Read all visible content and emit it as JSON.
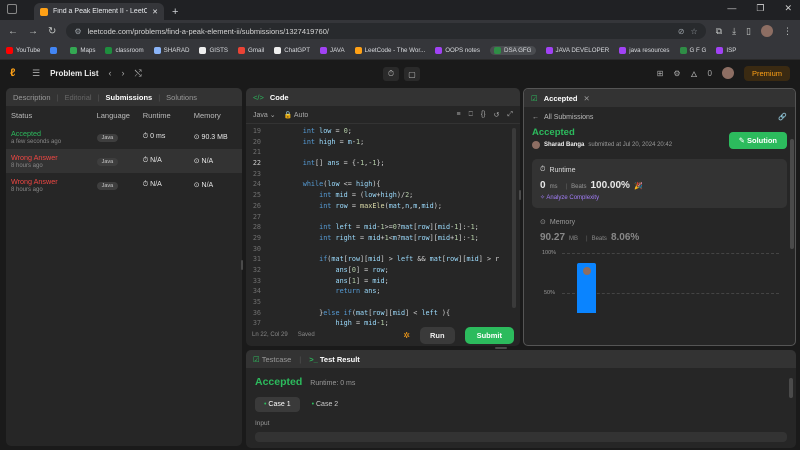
{
  "browser": {
    "tab_title": "Find a Peak Element II - LeetCo",
    "url": "leetcode.com/problems/find-a-peak-element-ii/submissions/1327419760/",
    "bookmarks": [
      {
        "label": "YouTube",
        "color": "#ff0000"
      },
      {
        "label": "",
        "color": "#4285f4"
      },
      {
        "label": "Maps",
        "color": "#34a853"
      },
      {
        "label": "classroom",
        "color": "#1e8e3e"
      },
      {
        "label": "SHARAD",
        "color": "#8ab4f8"
      },
      {
        "label": "GISTS",
        "color": "#eeeeee"
      },
      {
        "label": "Gmail",
        "color": "#ea4335"
      },
      {
        "label": "ChatGPT",
        "color": "#eeeeee"
      },
      {
        "label": "JAVA",
        "color": "#a142f4"
      },
      {
        "label": "LeetCode - The Wor...",
        "color": "#ffa116"
      },
      {
        "label": "OOPS notes",
        "color": "#a142f4"
      },
      {
        "label": "DSA GFG",
        "color": "#2f8d46"
      },
      {
        "label": "JAVA DEVELOPER",
        "color": "#a142f4"
      },
      {
        "label": "java resources",
        "color": "#a142f4"
      },
      {
        "label": "G F G",
        "color": "#2f8d46"
      },
      {
        "label": "ISP",
        "color": "#a142f4"
      }
    ]
  },
  "header": {
    "problem_list": "Problem List",
    "notifications": "0",
    "premium": "Premium"
  },
  "left_panel": {
    "tabs": [
      "Description",
      "Editorial",
      "Submissions",
      "Solutions"
    ],
    "columns": [
      "Status",
      "Language",
      "Runtime",
      "Memory"
    ],
    "rows": [
      {
        "status": "Accepted",
        "when": "a few seconds ago",
        "lang": "Java",
        "runtime": "0 ms",
        "memory": "90.3 MB"
      },
      {
        "status": "Wrong Answer",
        "when": "8 hours ago",
        "lang": "Java",
        "runtime": "N/A",
        "memory": "N/A"
      },
      {
        "status": "Wrong Answer",
        "when": "8 hours ago",
        "lang": "Java",
        "runtime": "N/A",
        "memory": "N/A"
      }
    ]
  },
  "code_panel": {
    "title": "Code",
    "language": "Java",
    "mode": "Auto",
    "cursor": "Ln 22, Col 29",
    "saved": "Saved",
    "run": "Run",
    "submit": "Submit"
  },
  "result_panel": {
    "tab": "Accepted",
    "back": "All Submissions",
    "status": "Accepted",
    "user": "Sharad Banga",
    "submitted": "submitted at Jul 20, 2024 20:42",
    "solution": "Solution",
    "runtime_label": "Runtime",
    "runtime_value": "0",
    "runtime_unit": "ms",
    "beats": "Beats",
    "runtime_beats": "100.00%",
    "analyze": "Analyze Complexity",
    "memory_label": "Memory",
    "memory_value": "90.27",
    "memory_unit": "MB",
    "memory_beats": "8.06%",
    "y100": "100%",
    "y50": "50%"
  },
  "test_panel": {
    "tab1": "Testcase",
    "tab2": "Test Result",
    "status": "Accepted",
    "runtime": "Runtime: 0 ms",
    "case1": "Case 1",
    "case2": "Case 2",
    "input": "Input"
  }
}
